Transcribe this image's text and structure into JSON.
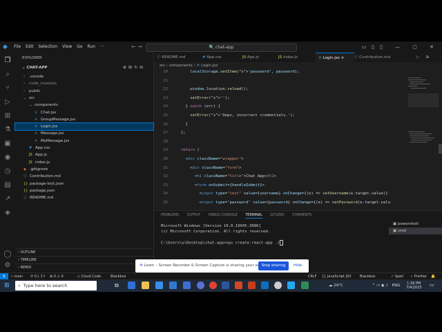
{
  "titlebar": {
    "menu": [
      "File",
      "Edit",
      "Selection",
      "View",
      "Go",
      "Run",
      "···"
    ],
    "search": "chat-app"
  },
  "sidebar": {
    "header": "EXPLORER",
    "project": "CHAT-APP",
    "items": [
      {
        "label": ".vscode",
        "kind": "folder"
      },
      {
        "label": "node_modules",
        "kind": "folder"
      },
      {
        "label": "public",
        "kind": "folder"
      },
      {
        "label": "src",
        "kind": "folder-open"
      },
      {
        "label": "components",
        "kind": "folder-open"
      },
      {
        "label": "Chat.jsx",
        "kind": "jsx"
      },
      {
        "label": "GroupMessage.jsx",
        "kind": "jsx"
      },
      {
        "label": "Login.jsx",
        "kind": "jsx",
        "selected": true
      },
      {
        "label": "Message.jsx",
        "kind": "jsx"
      },
      {
        "label": "MyMessage.jsx",
        "kind": "jsx"
      },
      {
        "label": "App.css",
        "kind": "css"
      },
      {
        "label": "App.js",
        "kind": "js"
      },
      {
        "label": "index.js",
        "kind": "js"
      },
      {
        "label": ".gitignore",
        "kind": "git"
      },
      {
        "label": "Contribution.md",
        "kind": "md"
      },
      {
        "label": "package-lock.json",
        "kind": "json"
      },
      {
        "label": "package.json",
        "kind": "json"
      },
      {
        "label": "README.md",
        "kind": "md"
      }
    ],
    "sections": [
      "OUTLINE",
      "TIMELINE",
      "REMIX"
    ]
  },
  "tabs": [
    {
      "label": "README.md"
    },
    {
      "label": "App.css"
    },
    {
      "label": "App.js"
    },
    {
      "label": "index.js"
    },
    {
      "label": "Login.jsx",
      "active": true
    },
    {
      "label": "Contribution.md"
    }
  ],
  "breadcrumb": [
    "src",
    "components",
    "Login.jsx"
  ],
  "code": {
    "line_numbers": [
      "20",
      "21",
      "22",
      "23",
      "24",
      "25",
      "26",
      "27",
      "28",
      "29",
      "30",
      "31",
      "32",
      "33",
      "34",
      "35"
    ],
    "lines": [
      "      localStorage.setItem('password', password);",
      "",
      "      window.location.reload();",
      "      setError('');",
      "    } catch (err) {",
      "      setError('Oops, incorrect credentials.');",
      "    }",
      "  };",
      "",
      "  return (",
      "    <div className=\"wrapper\">",
      "      <div className=\"form\">",
      "        <h1 className=\"title\">Chat App</h1>",
      "        <form onSubmit={handleSubmit}>",
      "          <input type=\"text\" value={username} onChange={(e) => setUsername(e.target.value)}",
      "          <input type=\"password\" value={password} onChange={(e) => setPassword(e.target.valu"
    ]
  },
  "panel": {
    "tabs": [
      "PROBLEMS",
      "OUTPUT",
      "DEBUG CONSOLE",
      "TERMINAL",
      "GITLENS",
      "COMMENTS"
    ],
    "active_tab": "TERMINAL",
    "terminal_lines": [
      "Microsoft Windows [Version 10.0.19045.3086]",
      "(c) Microsoft Corporation. All rights reserved.",
      "",
      "C:\\Users\\u\\Desktop\\chat-app>npx create-react-app ./"
    ],
    "terminals": [
      "powershell",
      "cmd"
    ]
  },
  "status": {
    "branch": "main",
    "sync": "⟳ 0↓ 1↑",
    "problems": "⊗ 0 ⚠ 0",
    "cloud": "Cloud Code",
    "blackbox": "Blackbox",
    "crlf": "CRLF",
    "lang": "JavaScript JSX",
    "blackbox2": "Blackbox",
    "spell": "✓ Spell",
    "prettier": "✓ Prettier"
  },
  "loom": {
    "message": "Loom – Screen Recorder & Screen Capture is sharing your screen.",
    "stop": "Stop sharing",
    "hide": "Hide"
  },
  "taskbar": {
    "search_placeholder": "Type here to search",
    "weather": "29°C",
    "lang": "ENG",
    "time": "1:39 PM",
    "date": "7/4/2023"
  }
}
